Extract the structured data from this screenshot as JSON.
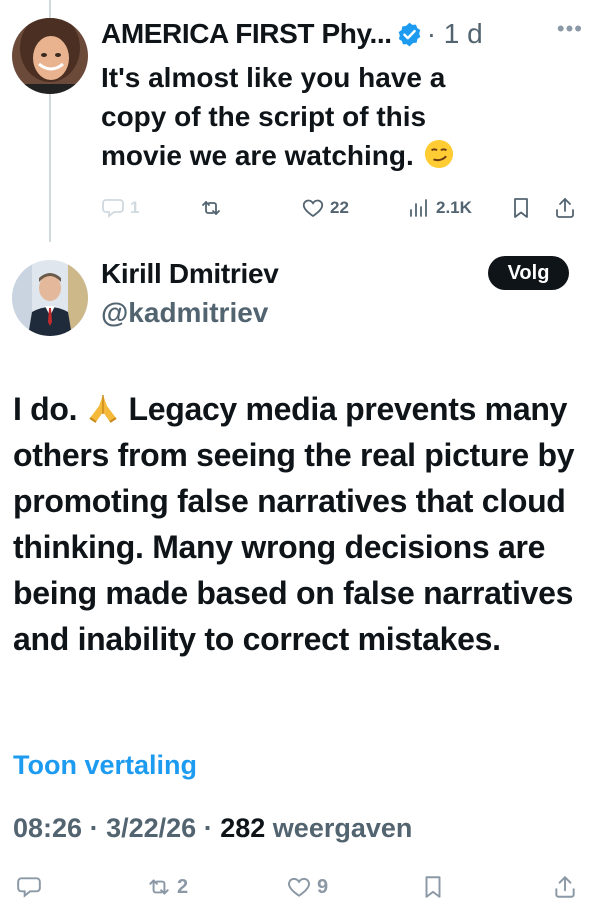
{
  "reply": {
    "author_name": "AMERICA FIRST Phy...",
    "age": "· 1 d",
    "more_icon": "more-horizontal-icon",
    "text": "It's almost like you have a\ncopy of the script of this\nmovie we are watching.",
    "emoji": "smirking-face-emoji",
    "actions": {
      "reply_count": "1",
      "repost_count": "",
      "like_count": "22",
      "views_count": "2.1K"
    },
    "verified_color": "#1d9bf0"
  },
  "tweet": {
    "author_name": "Kirill Dmitriev",
    "handle": "@kadmitriev",
    "follow_label": "Volg",
    "text_part1": "I do. ",
    "text_part2": " Legacy media prevents many others from seeing the real picture by promoting false narratives that cloud thinking. Many wrong decisions are being made based on false narratives and inability to correct mistakes.",
    "emoji": "folded-hands-emoji",
    "translate_label": "Toon vertaling",
    "time": "08:26",
    "date": "3/22/26",
    "views_count": "282",
    "views_label": "weergaven",
    "separator": "·"
  },
  "bottom_actions": {
    "reply_count": "",
    "repost_count": "2",
    "like_count": "9"
  },
  "colors": {
    "text": "#0f1419",
    "secondary": "#536471",
    "link": "#1d9bf0",
    "thread_line": "#cfd9de",
    "button_bg": "#0f1419"
  }
}
